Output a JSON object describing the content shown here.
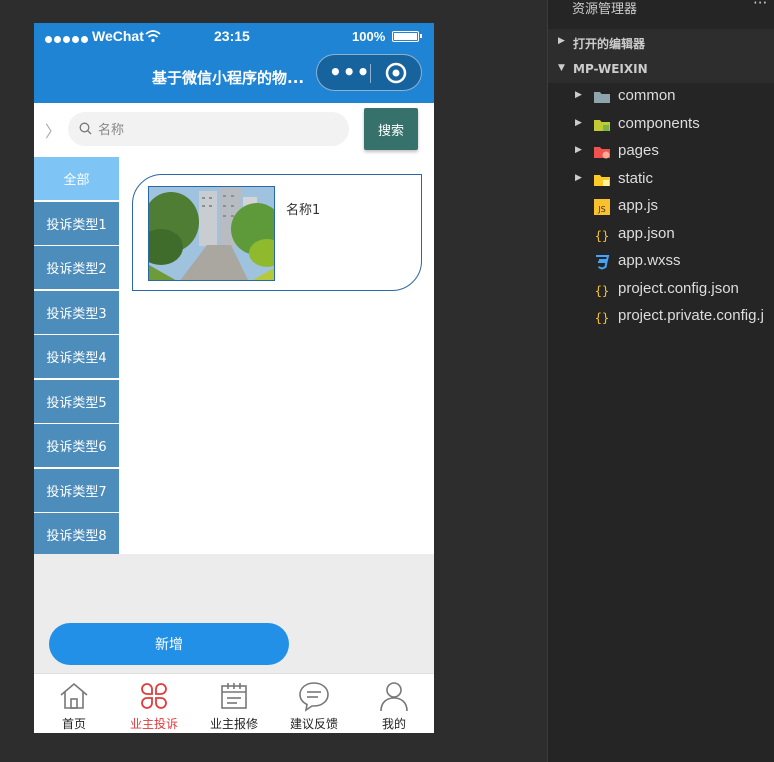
{
  "status_bar": {
    "carrier": "WeChat",
    "time": "23:15",
    "battery": "100%"
  },
  "nav_bar": {
    "title": "基于微信小程序的物..."
  },
  "search": {
    "placeholder": "名称",
    "button_label": "搜索"
  },
  "categories": [
    "全部",
    "投诉类型1",
    "投诉类型2",
    "投诉类型3",
    "投诉类型4",
    "投诉类型5",
    "投诉类型6",
    "投诉类型7",
    "投诉类型8"
  ],
  "active_category": "全部",
  "items": [
    {
      "name": "名称1"
    }
  ],
  "add_button_label": "新增",
  "tabs": [
    {
      "label": "首页",
      "icon": "home-icon"
    },
    {
      "label": "业主投诉",
      "icon": "complaint-icon"
    },
    {
      "label": "业主报修",
      "icon": "repair-icon"
    },
    {
      "label": "建议反馈",
      "icon": "feedback-icon"
    },
    {
      "label": "我的",
      "icon": "user-icon"
    }
  ],
  "active_tab": "业主投诉",
  "colors": {
    "primary": "#1f84d3",
    "search_button": "#37716c",
    "category": "#4d8dbb",
    "category_active": "#7ec4f4",
    "tab_active": "#e33b3b",
    "add_button": "#2190e6"
  },
  "explorer": {
    "title": "资源管理器",
    "open_editors": "打开的编辑器",
    "project": "MP-WEIXIN",
    "files": [
      {
        "name": "common",
        "type": "folder",
        "icon": "folder-icon"
      },
      {
        "name": "components",
        "type": "folder",
        "icon": "components-folder-icon"
      },
      {
        "name": "pages",
        "type": "folder",
        "icon": "pages-folder-icon"
      },
      {
        "name": "static",
        "type": "folder",
        "icon": "static-folder-icon"
      },
      {
        "name": "app.js",
        "type": "file",
        "icon": "js-file-icon"
      },
      {
        "name": "app.json",
        "type": "file",
        "icon": "json-file-icon"
      },
      {
        "name": "app.wxss",
        "type": "file",
        "icon": "css-file-icon"
      },
      {
        "name": "project.config.json",
        "type": "file",
        "icon": "json-file-icon"
      },
      {
        "name": "project.private.config.j",
        "type": "file",
        "icon": "json-file-icon"
      }
    ]
  }
}
